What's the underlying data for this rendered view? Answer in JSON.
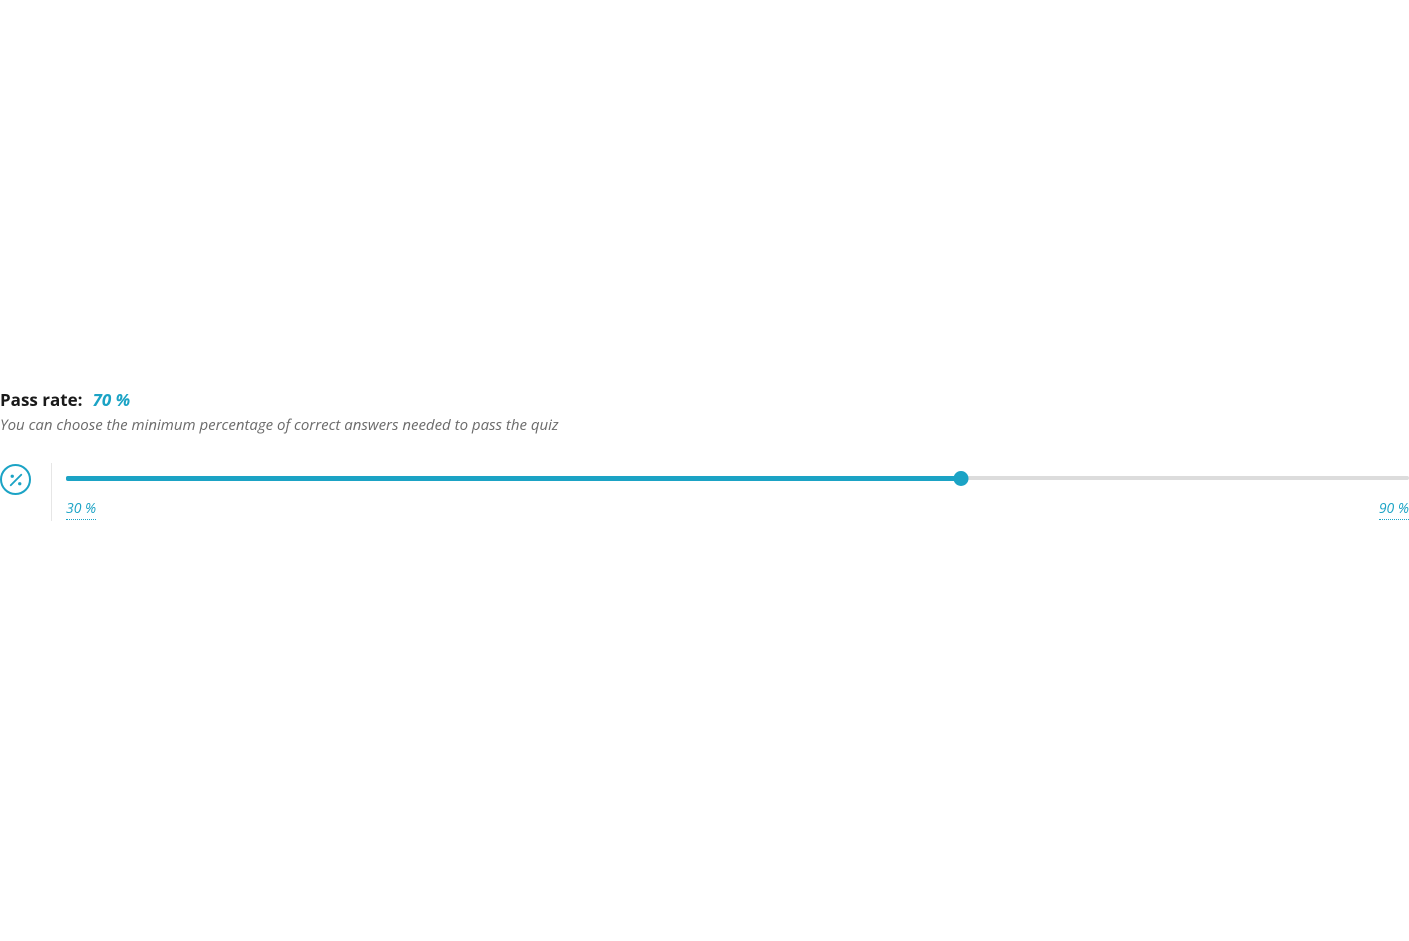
{
  "passRate": {
    "label": "Pass rate:",
    "value": "70 %",
    "description": "You can choose the minimum percentage of correct answers needed to pass the quiz"
  },
  "slider": {
    "minLabel": "30 %",
    "maxLabel": "90 %",
    "min": 30,
    "max": 90,
    "current": 70
  },
  "colors": {
    "accent": "#1ba3c5"
  }
}
